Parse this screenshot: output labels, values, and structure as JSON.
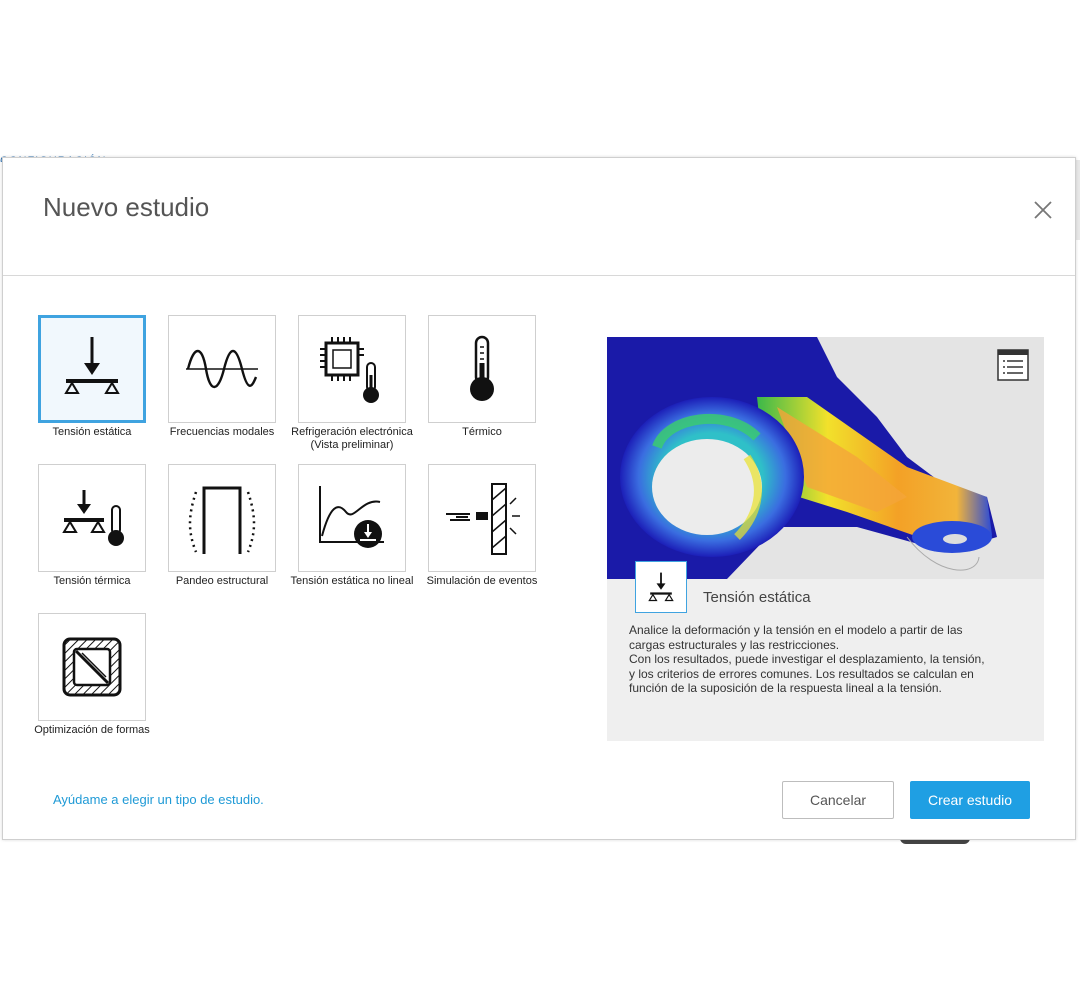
{
  "background": {
    "text": "CONFIGURACIÓN"
  },
  "dialog": {
    "title": "Nuevo estudio"
  },
  "study_types": [
    {
      "id": "static",
      "label": "Tensión estática",
      "icon": "static-stress-icon",
      "selected": true
    },
    {
      "id": "modal",
      "label": "Frecuencias modales",
      "icon": "sine-wave-icon",
      "selected": false
    },
    {
      "id": "electronics",
      "label": "Refrigeración electrónica (Vista preliminar)",
      "icon": "chip-thermometer-icon",
      "selected": false
    },
    {
      "id": "thermal",
      "label": "Térmico",
      "icon": "thermometer-icon",
      "selected": false
    },
    {
      "id": "thermal-stress",
      "label": "Tensión térmica",
      "icon": "thermal-stress-icon",
      "selected": false
    },
    {
      "id": "buckling",
      "label": "Pandeo estructural",
      "icon": "buckling-icon",
      "selected": false
    },
    {
      "id": "nonlinear",
      "label": "Tensión estática no lineal",
      "icon": "nonlinear-curve-icon",
      "selected": false
    },
    {
      "id": "events",
      "label": "Simulación de eventos",
      "icon": "impact-wall-icon",
      "selected": false
    },
    {
      "id": "shape",
      "label": "Optimización de formas",
      "icon": "shape-optimization-icon",
      "selected": false
    }
  ],
  "preview": {
    "title": "Tensión estática",
    "description_lines": [
      "Analice la deformación y la tensión en el modelo a partir de las",
      "cargas estructurales y las restricciones.",
      "Con los resultados, puede investigar el desplazamiento, la tensión,",
      "y los criterios de errores comunes. Los resultados se calculan en",
      "función de la suposición de la respuesta lineal a la tensión."
    ]
  },
  "footer": {
    "help_link": "Ayúdame a elegir un tipo de estudio.",
    "cancel_label": "Cancelar",
    "create_label": "Crear estudio"
  },
  "colors": {
    "accent": "#1f9fe3",
    "selected_border": "#3fa3e0",
    "link": "#1f9ad6"
  }
}
